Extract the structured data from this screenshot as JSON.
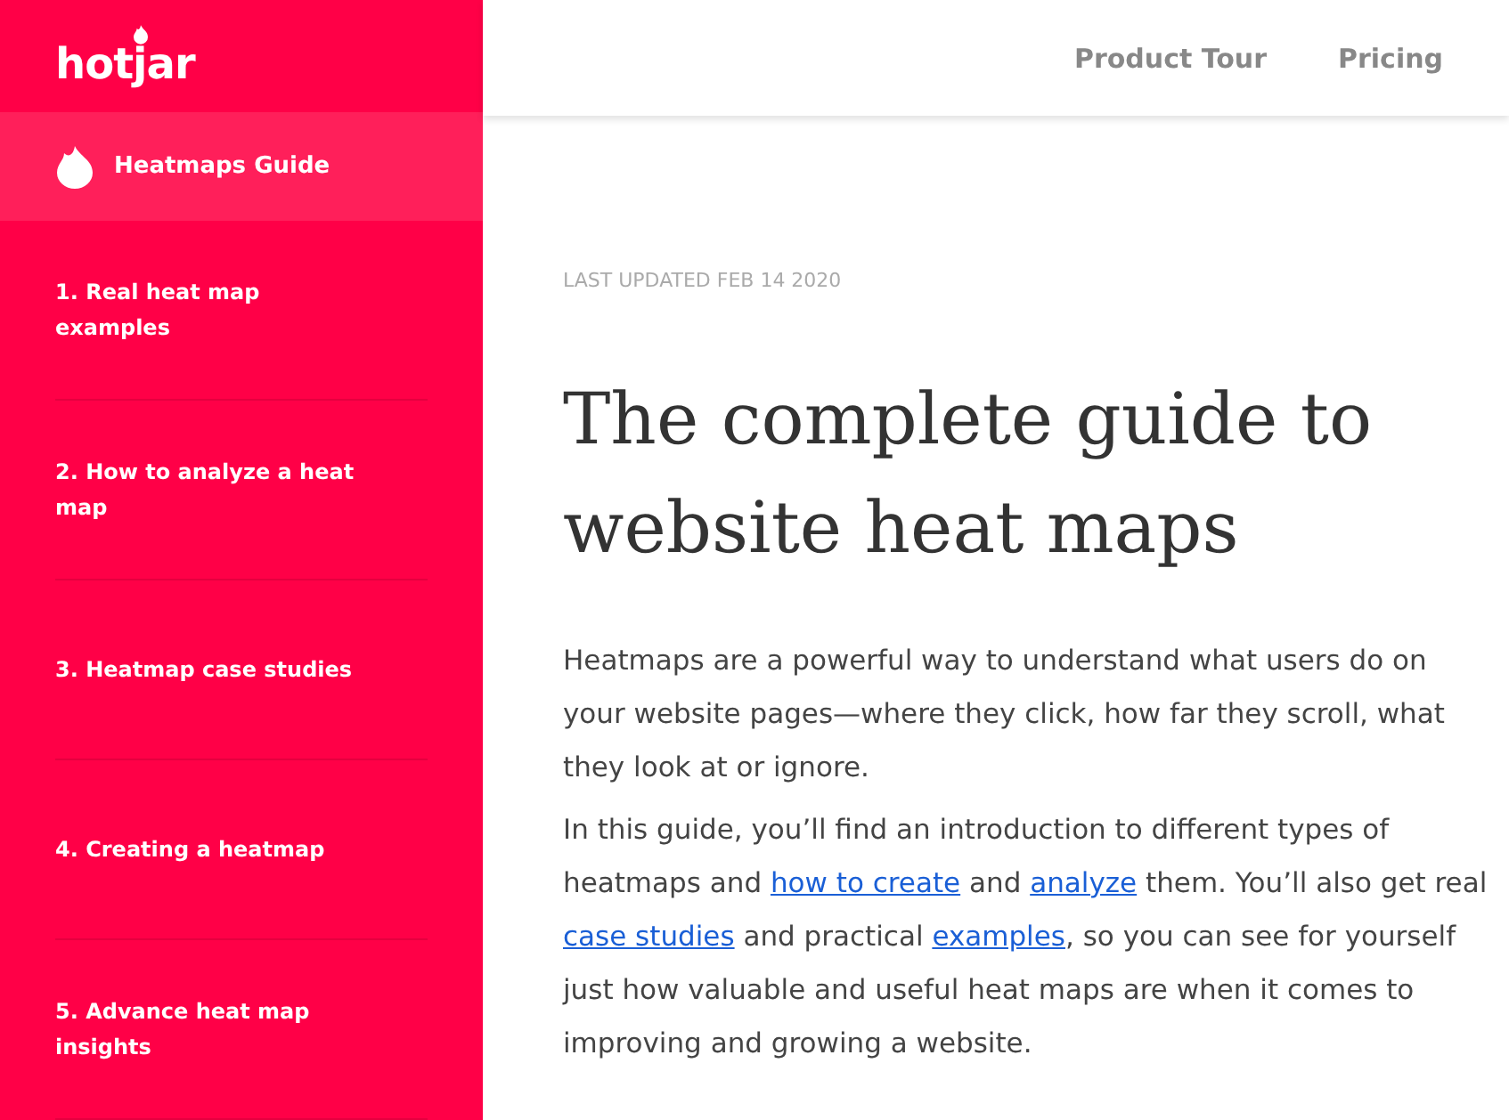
{
  "sidebar": {
    "logo": "hotjar",
    "guide_title": "Heatmaps Guide",
    "items": [
      {
        "label": "1. Real heat map examples"
      },
      {
        "label": "2. How to analyze a heat map"
      },
      {
        "label": "3. Heatmap case studies"
      },
      {
        "label": "4. Creating a heatmap"
      },
      {
        "label": "5. Advance heat map insights"
      }
    ]
  },
  "top_nav": {
    "links": [
      "Product Tour",
      "Pricing"
    ]
  },
  "article": {
    "updated": "LAST UPDATED FEB 14 2020",
    "title": "The complete guide to website heat maps",
    "paragraphs": [
      [
        {
          "text": "Heatmaps are a powerful way to understand what users do on your website pages—where they click, how far they scroll, what they look at or ignore.",
          "link": false
        }
      ],
      [
        {
          "text": "In this guide, you’ll find an introduction to different types of heatmaps and ",
          "link": false
        },
        {
          "text": "how to create",
          "link": true
        },
        {
          "text": " and ",
          "link": false
        },
        {
          "text": "analyze",
          "link": true
        },
        {
          "text": " them. You’ll also get real ",
          "link": false
        },
        {
          "text": "case studies",
          "link": true
        },
        {
          "text": " and practical ",
          "link": false
        },
        {
          "text": "examples",
          "link": true
        },
        {
          "text": ", so you can see for yourself just how valuable and useful heat maps are when it comes to improving and growing a website.",
          "link": false
        }
      ]
    ]
  }
}
